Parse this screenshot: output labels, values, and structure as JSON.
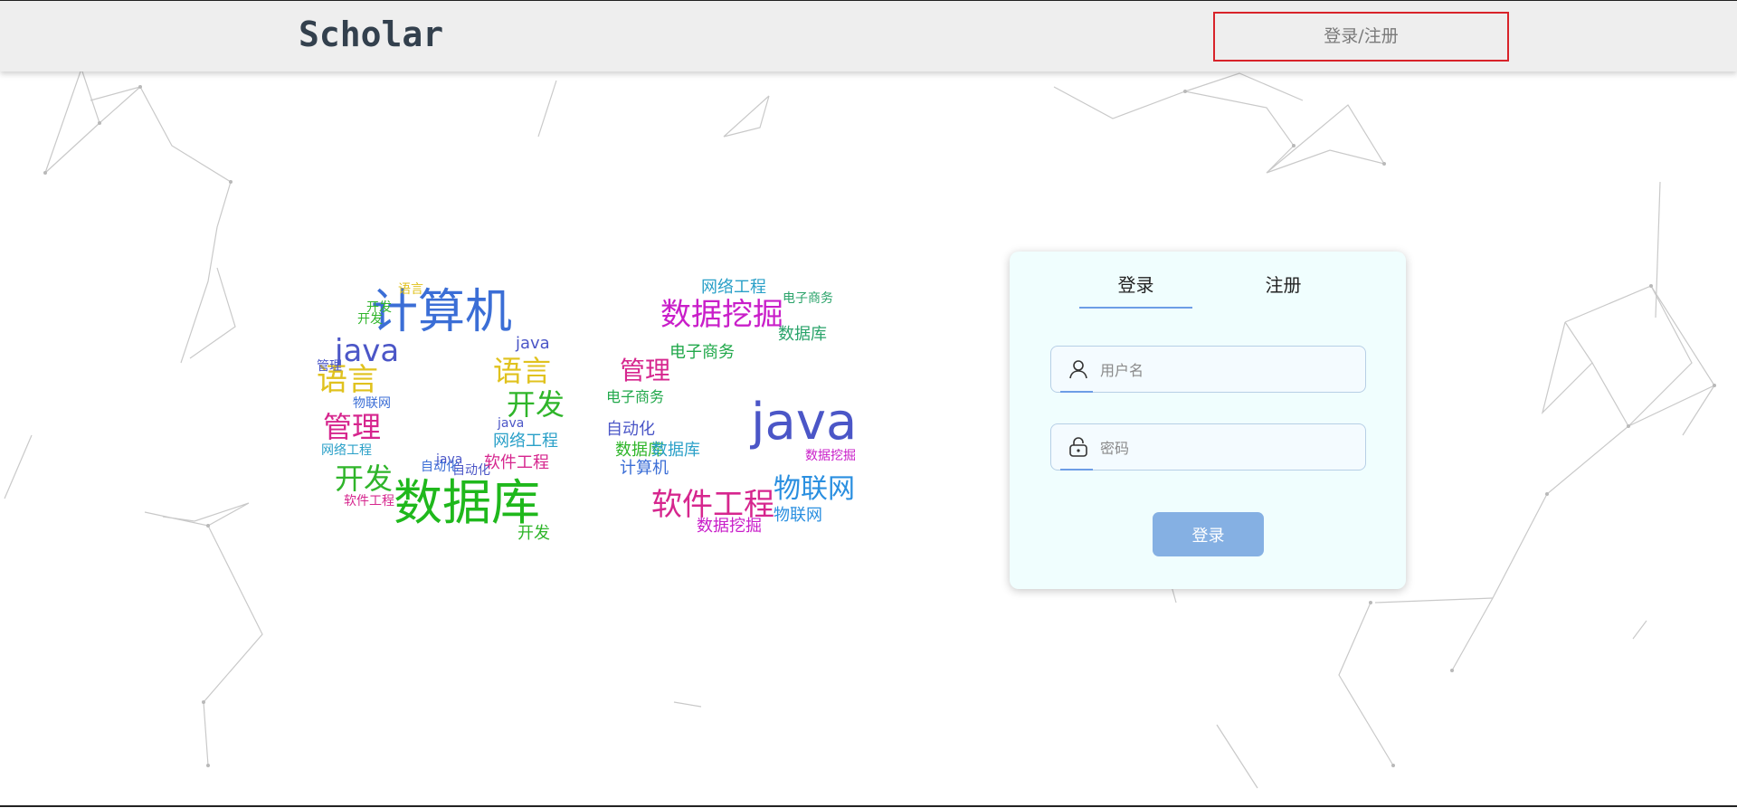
{
  "header": {
    "logo": "Scholar",
    "login_register_label": "登录/注册"
  },
  "login_card": {
    "tabs": [
      {
        "label": "登录",
        "active": true
      },
      {
        "label": "注册",
        "active": false
      }
    ],
    "username": {
      "placeholder": "用户名",
      "value": "",
      "icon": "user-icon"
    },
    "password": {
      "placeholder": "密码",
      "value": "",
      "icon": "lock-icon"
    },
    "submit_label": "登录"
  },
  "wordcloud": {
    "words": [
      "计算机",
      "java",
      "语言",
      "开发",
      "管理",
      "网络工程",
      "物联网",
      "数据库",
      "软件工程",
      "自动化",
      "数据挖掘",
      "电子商务",
      "数据库",
      "电子商务",
      "管理",
      "自动化",
      "电子商务",
      "数据库",
      "计算机",
      "java",
      "软件工程",
      "数据挖掘",
      "物联网",
      "物联网",
      "数据挖掘",
      "网络工程",
      "java",
      "开发",
      "语言",
      "开发",
      "管理",
      "java",
      "语言",
      "开发",
      "网络工程",
      "软件工程",
      "java",
      "自动化",
      "数据库",
      "开发"
    ]
  },
  "colors": {
    "header_bg": "#eeeeee",
    "logo": "#33404d",
    "header_button_border": "#d8232a",
    "card_bg": "#f0fefe",
    "accent": "#6d9de6",
    "submit_bg": "#85b0e3"
  }
}
